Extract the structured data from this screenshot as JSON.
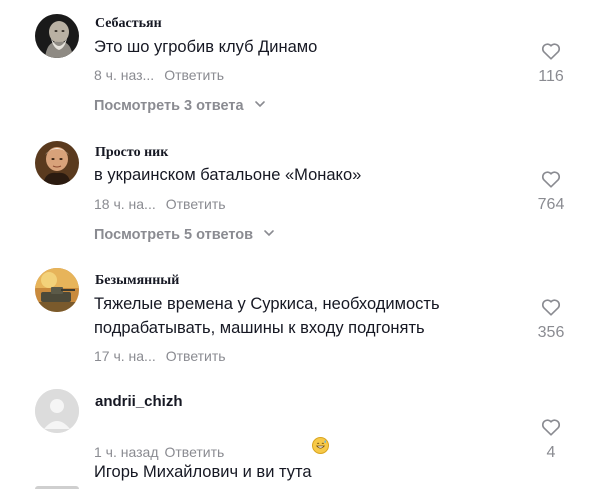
{
  "comments": [
    {
      "author": "Себастьян",
      "text": "Это шо угробив клуб Динамо",
      "time": "8 ч. наз...",
      "reply_label": "Ответить",
      "likes": "116",
      "view_replies": "Посмотреть 3 ответа",
      "avatar": "old-man-portrait"
    },
    {
      "author": "Просто ник",
      "text": "в украинском батальоне «Монако»",
      "time": "18 ч. на...",
      "reply_label": "Ответить",
      "likes": "764",
      "view_replies": "Посмотреть 5 ответов",
      "avatar": "man-portrait-painting"
    },
    {
      "author": "Безымянный",
      "text": "Тяжелые времена у Суркиса, необходимость\nподрабатывать, машины к входу подгонять",
      "time": "17 ч. на...",
      "reply_label": "Ответить",
      "likes": "356",
      "avatar": "burning-tank"
    },
    {
      "author": "andrii_chizh",
      "text": "Игорь Михайлович и ви тута",
      "emoji": "grinning-sweat-emoji",
      "time": "1 ч. назад",
      "reply_label": "Ответить",
      "likes": "4",
      "avatar": "default-avatar"
    }
  ],
  "colors": {
    "text": "#161823",
    "secondary": "#8a8b91"
  },
  "icons": {
    "like": "heart-outline-icon",
    "expand": "chevron-down-icon"
  }
}
